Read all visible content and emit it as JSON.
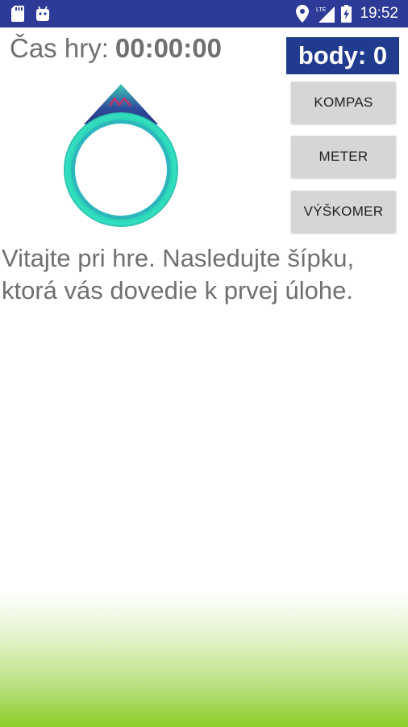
{
  "status_bar": {
    "time": "19:52",
    "background": "#2d3a97",
    "left_icons": [
      "sd-card-icon",
      "android-icon"
    ],
    "right_icons": [
      "location-icon",
      "lte-signal-icon",
      "battery-charging-icon"
    ]
  },
  "timer": {
    "label": "Čas hry:",
    "value": "00:00:00"
  },
  "score": {
    "text": "body: 0",
    "background": "#213b8e"
  },
  "buttons": {
    "kompas": "KOMPAS",
    "meter": "METER",
    "vyskomer": "VÝŠKOMER"
  },
  "message": "Vitajte pri hre. Nasledujte šípku, ktorá vás dovedie k prvej úlohe.",
  "colors": {
    "accent_teal": "#2ad6b8",
    "arrow_blue": "#2f4c9c",
    "arrow_mark": "#c0336b",
    "gradient_green": "#8ccd28"
  }
}
